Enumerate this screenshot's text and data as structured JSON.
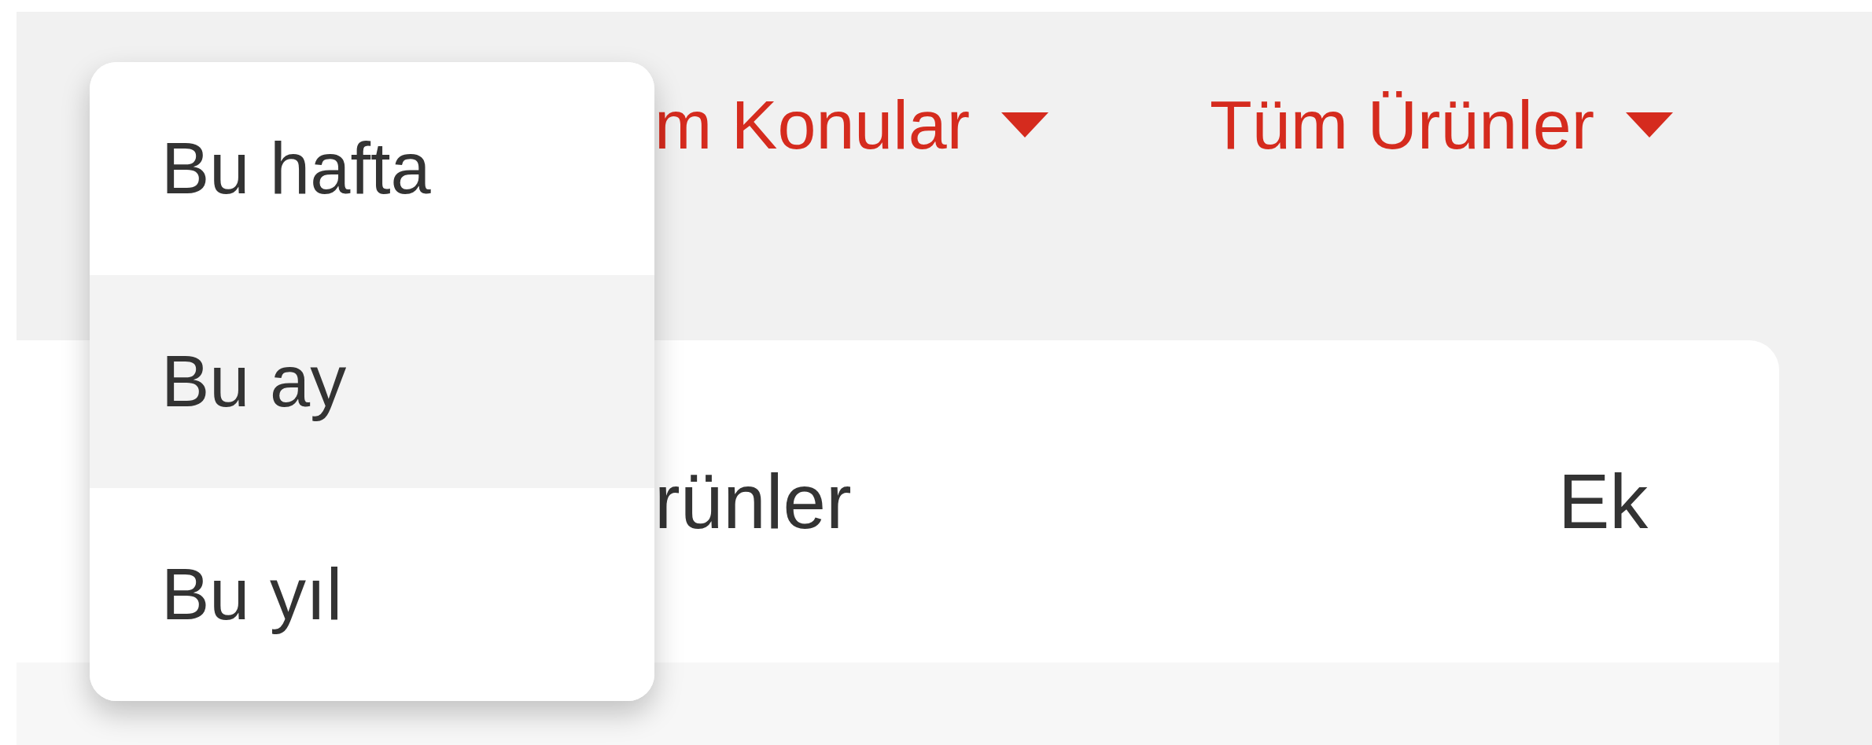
{
  "filters": [
    {
      "label": "m Konular"
    },
    {
      "label": "Tüm Ürünler"
    }
  ],
  "table": {
    "columns": [
      "rünler",
      "Ek"
    ]
  },
  "period_menu": {
    "items": [
      {
        "label": "Bu hafta",
        "selected": false
      },
      {
        "label": "Bu ay",
        "selected": true
      },
      {
        "label": "Bu yıl",
        "selected": false
      }
    ]
  }
}
